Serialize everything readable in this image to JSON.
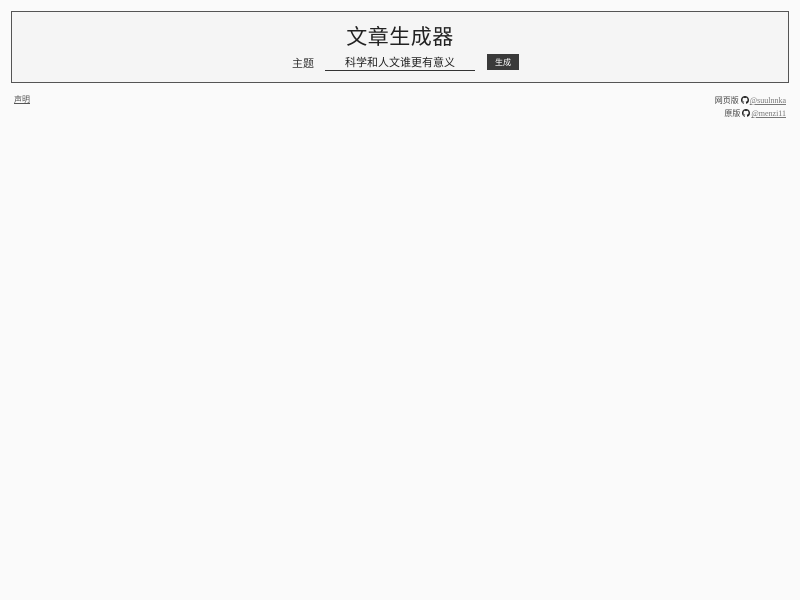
{
  "header": {
    "title": "文章生成器",
    "topic_label": "主题",
    "topic_value": "科学和人文谁更有意义",
    "generate_label": "生成"
  },
  "footer": {
    "disclaimer_label": "声明",
    "credits": [
      {
        "label": "网页版",
        "icon": "github-icon",
        "handle": "@suulnnka"
      },
      {
        "label": "原版",
        "icon": "github-icon",
        "handle": "@menzi11"
      }
    ]
  },
  "colors": {
    "background": "#fafafa",
    "header_background": "#f5f5f5",
    "border": "#555555",
    "button": "#3a3a3a",
    "link": "#777777"
  }
}
